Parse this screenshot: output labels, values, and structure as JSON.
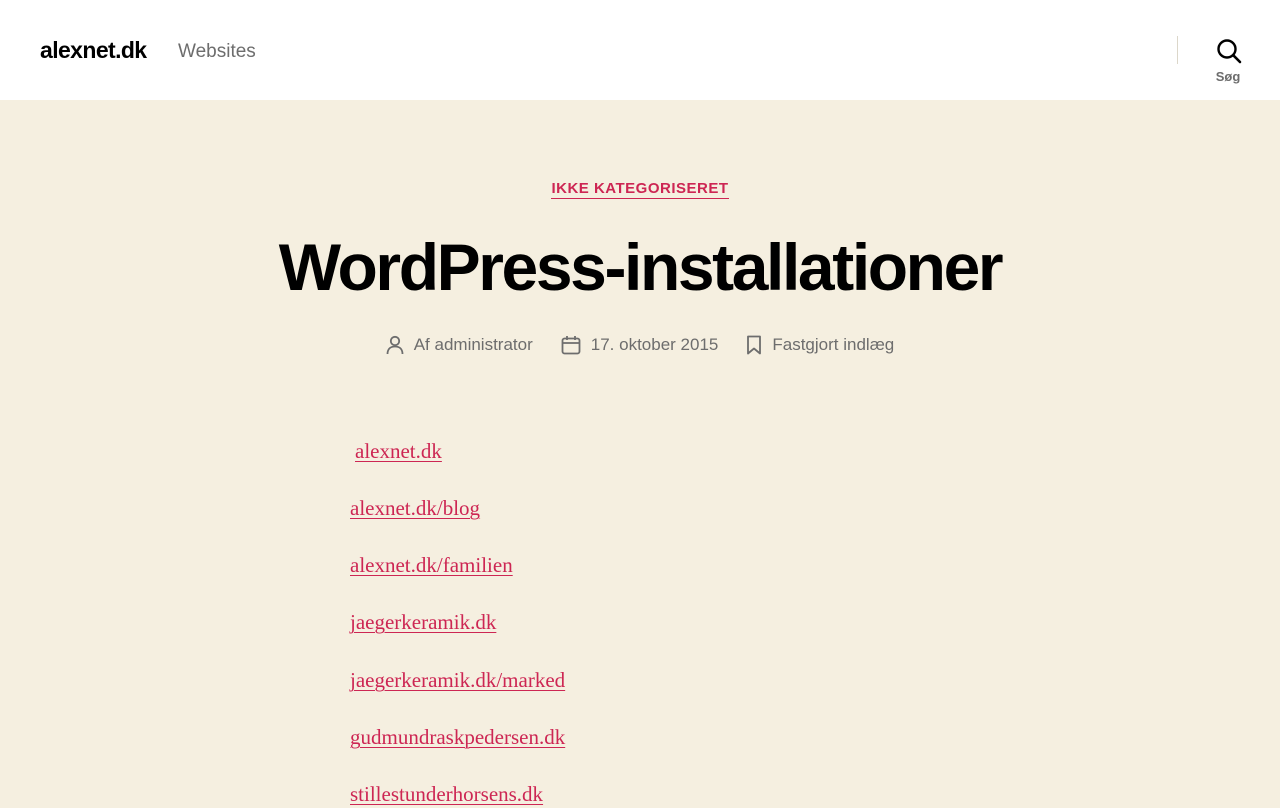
{
  "header": {
    "site_title": "alexnet.dk",
    "site_description": "Websites",
    "search_label": "Søg"
  },
  "post": {
    "category": "IKKE KATEGORISERET",
    "title": "WordPress-installationer",
    "meta": {
      "author": "Af administrator",
      "date": "17. oktober 2015",
      "sticky": "Fastgjort indlæg"
    },
    "links": [
      "alexnet.dk",
      "alexnet.dk/blog",
      "alexnet.dk/familien",
      "jaegerkeramik.dk",
      "jaegerkeramik.dk/marked",
      "gudmundraskpedersen.dk",
      "stillestunderhorsens.dk"
    ]
  },
  "colors": {
    "accent": "#cd2653",
    "background": "#f5efe0",
    "header_background": "#ffffff",
    "meta_text": "#6d6d6d"
  },
  "icons": {
    "search": "search-icon",
    "author": "user-icon",
    "date": "calendar-icon",
    "sticky": "bookmark-icon"
  }
}
